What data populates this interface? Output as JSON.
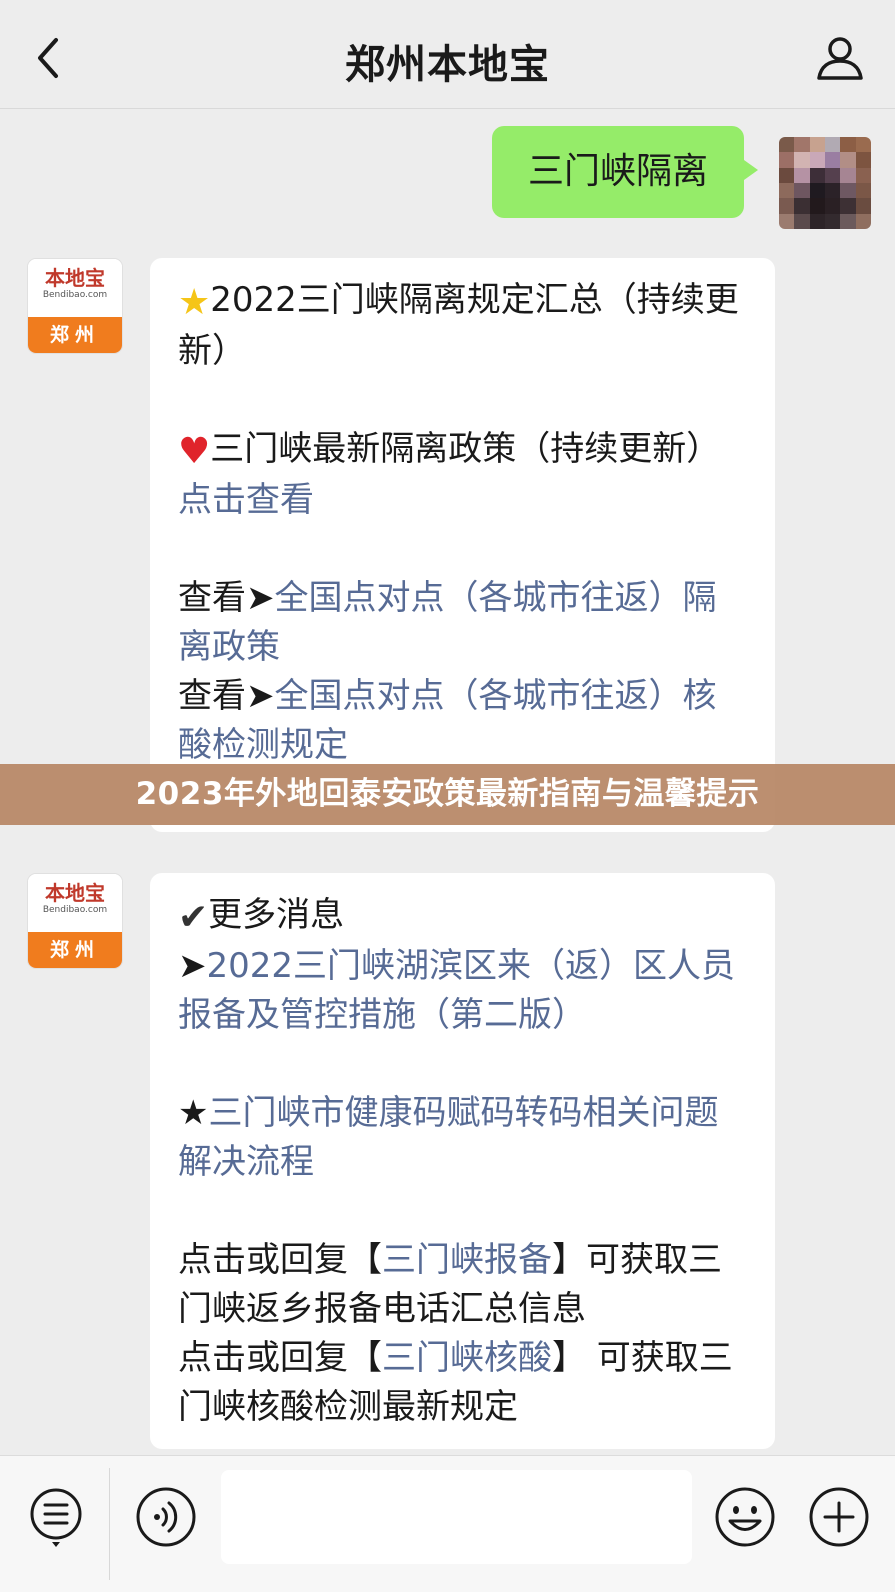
{
  "header": {
    "title": "郑州本地宝"
  },
  "chat": {
    "outgoing": {
      "text": "三门峡隔离"
    },
    "bot_avatar": {
      "brand": "本地宝",
      "sub": "Bendibao.com",
      "city": "郑州"
    },
    "message1": {
      "l1_text": "2022三门峡隔离规定汇总（持续更新）",
      "l2_text": "三门峡最新隔离政策（持续更新）",
      "l3_link": "点击查看",
      "l4_prefix": "查看➤",
      "l4_link": "全国点对点（各城市往返）隔离政策",
      "l5_prefix": "查看➤",
      "l5_link": "全国点对点（各城市往返）核酸检测规定"
    },
    "message2": {
      "l1_text": "更多消息",
      "l2_prefix": "➤",
      "l2_link": "2022三门峡湖滨区来（返）区人员报备及管控措施（第二版）",
      "l3_prefix": "★",
      "l3_link": "三门峡市健康码赋码转码相关问题解决流程",
      "l4_pre": "点击或回复【",
      "l4_link": "三门峡报备",
      "l4_post": "】可获取三门峡返乡报备电话汇总信息",
      "l5_pre": "点击或回复【",
      "l5_link": "三门峡核酸",
      "l5_post": "】 可获取三门峡核酸检测最新规定"
    }
  },
  "banner": {
    "text": "2023年外地回泰安政策最新指南与温馨提示"
  },
  "toolbar": {
    "input_value": "",
    "icons": [
      "menu-icon",
      "voice-icon",
      "emoji-icon",
      "plus-icon"
    ]
  },
  "colors": {
    "background": "#ededed",
    "outgoing_bubble": "#95ec69",
    "link": "#576b95",
    "banner": "#b78665",
    "brand_orange": "#f07c1e"
  }
}
